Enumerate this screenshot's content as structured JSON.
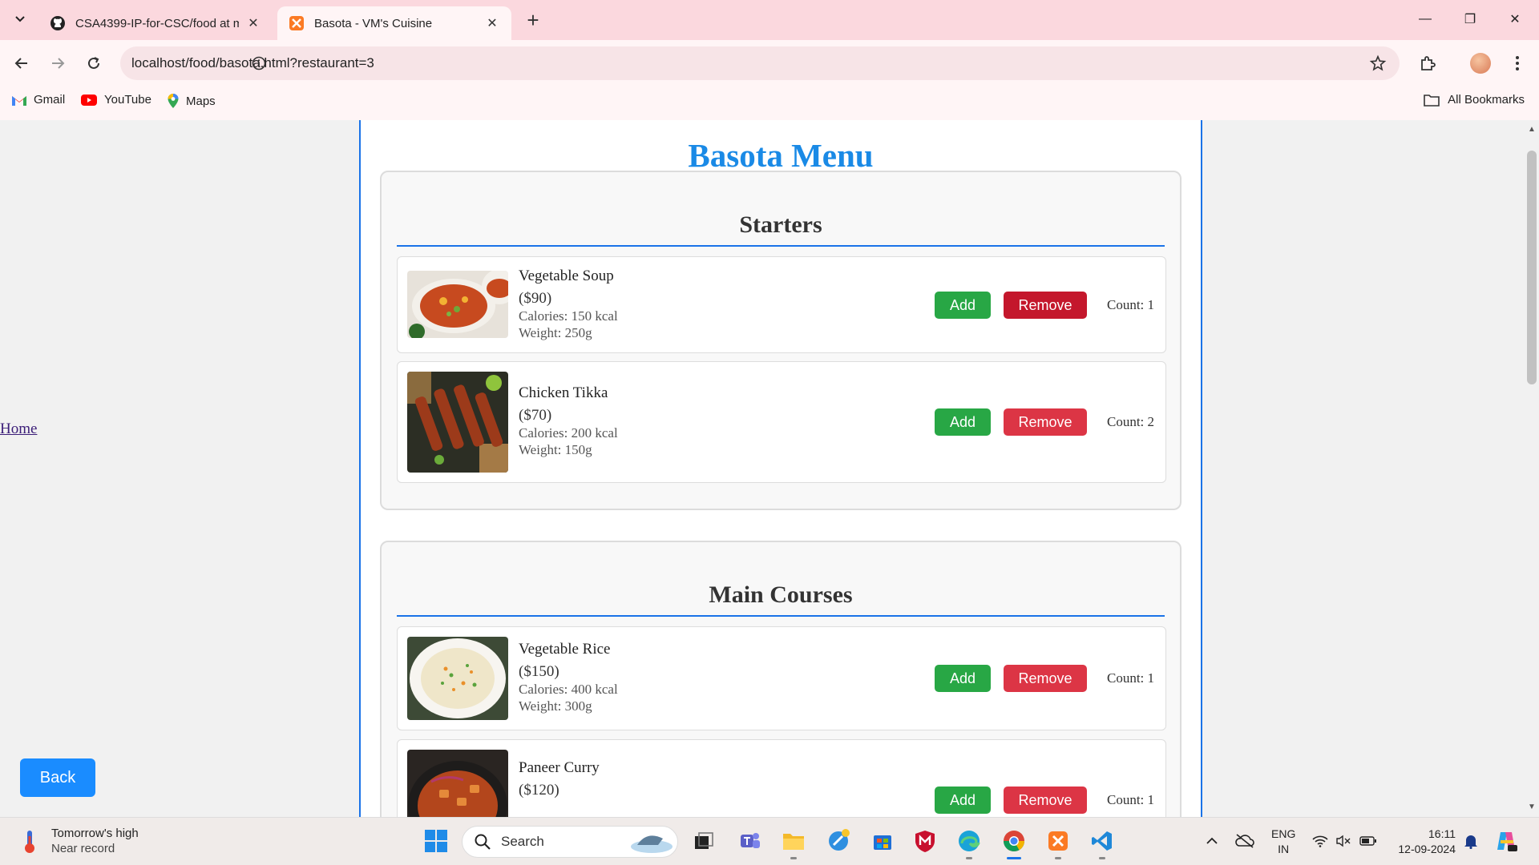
{
  "browser": {
    "tabs": [
      {
        "title": "CSA4399-IP-for-CSC/food at m",
        "icon": "github-icon"
      },
      {
        "title": "Basota - VM's Cuisine",
        "icon": "xampp-icon",
        "active": true
      }
    ],
    "address": "localhost/food/basota.html?restaurant=3",
    "bookmarks": [
      {
        "label": "Gmail",
        "icon": "gmail-icon"
      },
      {
        "label": "YouTube",
        "icon": "youtube-icon"
      },
      {
        "label": "Maps",
        "icon": "maps-icon"
      }
    ],
    "all_bookmarks": "All Bookmarks"
  },
  "page": {
    "home_link": "Home",
    "back_button": "Back",
    "title": "Basota Menu",
    "sections": [
      {
        "heading": "Starters",
        "items": [
          {
            "name": "Vegetable Soup",
            "price": "($90)",
            "calories": "Calories: 150 kcal",
            "weight": "Weight: 250g",
            "add": "Add",
            "remove": "Remove",
            "count": "Count: 1"
          },
          {
            "name": "Chicken Tikka",
            "price": "($70)",
            "calories": "Calories: 200 kcal",
            "weight": "Weight: 150g",
            "add": "Add",
            "remove": "Remove",
            "count": "Count: 2"
          }
        ]
      },
      {
        "heading": "Main Courses",
        "items": [
          {
            "name": "Vegetable Rice",
            "price": "($150)",
            "calories": "Calories: 400 kcal",
            "weight": "Weight: 300g",
            "add": "Add",
            "remove": "Remove",
            "count": "Count: 1"
          },
          {
            "name": "Paneer Curry",
            "price": "($120)",
            "add": "Add",
            "remove": "Remove",
            "count": "Count: 1"
          }
        ]
      }
    ]
  },
  "taskbar": {
    "weather_title": "Tomorrow's high",
    "weather_sub": "Near record",
    "search_label": "Search",
    "lang_1": "ENG",
    "lang_2": "IN",
    "time": "16:11",
    "date": "12-09-2024"
  },
  "colors": {
    "tab_strip": "#fbd8de",
    "toolbar": "#fff5f6",
    "title_blue": "#1a8ae6",
    "add_green": "#28a745",
    "remove_red": "#dc3545",
    "back_blue": "#1a8cff"
  }
}
